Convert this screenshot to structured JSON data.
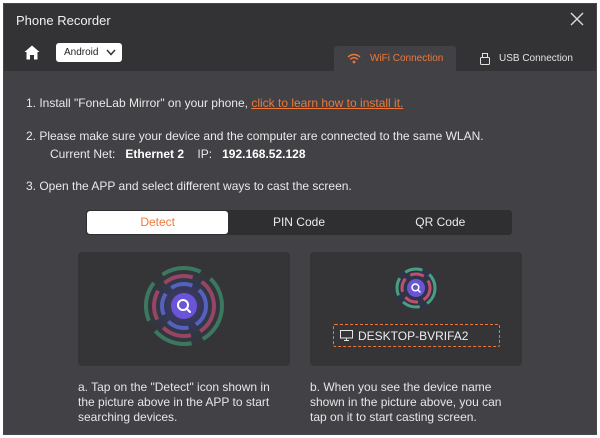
{
  "window": {
    "title": "Phone Recorder"
  },
  "toolbar": {
    "os_select": "Android",
    "tabs": [
      {
        "label": "WiFi Connection",
        "icon": "wifi-icon",
        "active": true
      },
      {
        "label": "USB Connection",
        "icon": "usb-icon",
        "active": false
      }
    ]
  },
  "steps": {
    "step1_text": "1. Install \"FoneLab Mirror\" on your phone, ",
    "step1_link": "click to learn how to install it.",
    "step2_text": "2. Please make sure your device and the computer are connected to the same WLAN.",
    "net_label": "Current Net:",
    "net_value": "Ethernet 2",
    "ip_label": "IP:",
    "ip_value": "192.168.52.128",
    "step3_text": "3. Open the APP and select different ways to cast the screen."
  },
  "cast_tabs": [
    {
      "label": "Detect",
      "active": true
    },
    {
      "label": "PIN Code",
      "active": false
    },
    {
      "label": "QR Code",
      "active": false
    }
  ],
  "device": {
    "name": "DESKTOP-BVRIFA2",
    "icon": "monitor-icon"
  },
  "descriptions": {
    "left": "a. Tap on the \"Detect\" icon shown in the picture above in the APP to start searching devices.",
    "right": "b. When you see the device name shown in the picture above, you can tap on it to start casting screen."
  },
  "colors": {
    "accent": "#ef7839",
    "background": "#424246",
    "titlebar": "#333336"
  }
}
